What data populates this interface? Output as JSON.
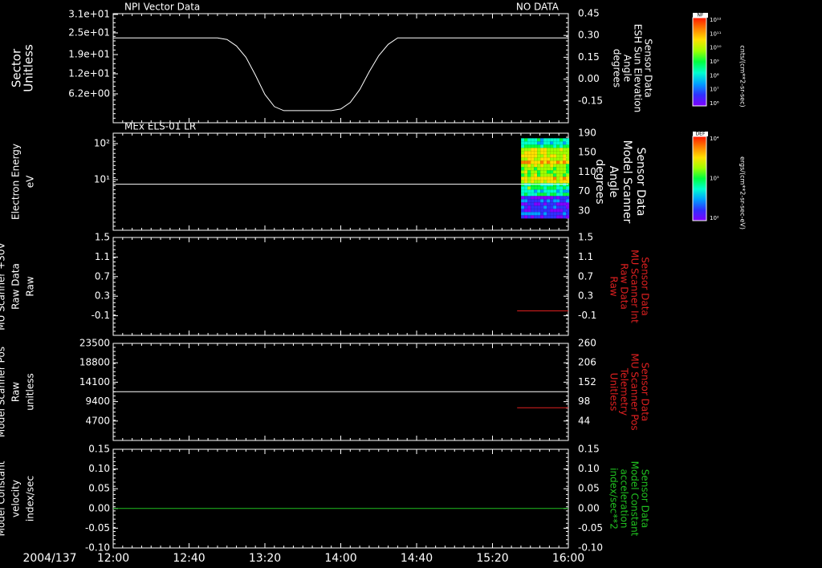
{
  "colors": {
    "background": "#000000",
    "axis": "#ffffff",
    "red": "#e02020",
    "green": "#20c020"
  },
  "chart_data": [
    {
      "type": "line",
      "title": "NPI Vector Data",
      "status": "NO DATA",
      "ylabel": [
        "Sector",
        "Unitless"
      ],
      "yticks": [
        "3.1e+01",
        "2.5e+01",
        "1.9e+01",
        "1.2e+01",
        "6.2e+00"
      ],
      "y2label": [
        "Sensor Data",
        "ESH Sun Elevation",
        "Angle",
        "degrees"
      ],
      "y2ticks": [
        "0.45",
        "0.30",
        "0.15",
        "0.00",
        "-0.15"
      ],
      "ylim2": [
        -0.225,
        0.45
      ],
      "series": [
        {
          "axis": "y2",
          "color": "#ffffff",
          "x": [
            "12:00",
            "12:55",
            "13:00",
            "13:05",
            "13:10",
            "13:15",
            "13:20",
            "13:25",
            "13:30",
            "13:55",
            "14:00",
            "14:05",
            "14:10",
            "14:15",
            "14:20",
            "14:25",
            "14:30",
            "16:00"
          ],
          "y": [
            0.3,
            0.3,
            0.29,
            0.25,
            0.18,
            0.07,
            -0.05,
            -0.125,
            -0.15,
            -0.15,
            -0.14,
            -0.1,
            -0.02,
            0.09,
            0.19,
            0.26,
            0.3,
            0.3
          ]
        }
      ]
    },
    {
      "type": "heatmap",
      "title": "MEx ELS-01 LR",
      "ylabel": [
        "Electron Energy",
        "eV"
      ],
      "yticks": [
        "10²",
        "10¹"
      ],
      "y2label": [
        "Sensor Data",
        "Model Scanner",
        "Angle",
        "degrees"
      ],
      "y2ticks": [
        "190",
        "150",
        "110",
        "70",
        "30"
      ],
      "ylim2": [
        0,
        190
      ],
      "line": {
        "axis": "y2",
        "x": [
          "12:00",
          "16:00"
        ],
        "y": [
          90,
          90
        ],
        "color": "#ffffff"
      },
      "spectrogram": {
        "x_start": "15:30",
        "x_end": "16:00",
        "y_start": 25,
        "y_end": 180
      },
      "colorbar": {
        "label": "DEF",
        "units": "ergs/(cm**2-sr-sec-eV)",
        "ticks": [
          "10⁴",
          "10³",
          "10²"
        ],
        "colors": [
          "#ff1800",
          "#ff8000",
          "#ffe000",
          "#a0ff00",
          "#00ff40",
          "#00ffd0",
          "#00a0ff",
          "#3030ff",
          "#8000ff"
        ]
      }
    },
    {
      "type": "line",
      "ylabel": [
        "Sensor Data",
        "MU Scanner +30V",
        "Raw Data",
        "Raw"
      ],
      "yticks": [
        "1.5",
        "1.1",
        "0.7",
        "0.3",
        "-0.1"
      ],
      "y2label": [
        "Sensor Data",
        "MU Scanner Int",
        "Raw Data",
        "Raw"
      ],
      "y2ticks": [
        "1.5",
        "1.1",
        "0.7",
        "0.3",
        "-0.1"
      ],
      "ylim2": [
        -0.5,
        1.5
      ],
      "series": [
        {
          "axis": "y2",
          "color": "#e02020",
          "x": [
            "15:33",
            "16:00"
          ],
          "y": [
            0.0,
            0.0
          ]
        }
      ]
    },
    {
      "type": "line",
      "ylabel": [
        "Sensor Data",
        "Model Scanner Pos",
        "Raw",
        "unitless"
      ],
      "yticks": [
        "23500",
        "18800",
        "14100",
        "9400",
        "4700"
      ],
      "y2label": [
        "Sensor Data",
        "MU Scanner Pos",
        "Telemetry",
        "Unitless"
      ],
      "y2ticks": [
        "260",
        "206",
        "152",
        "98",
        "44"
      ],
      "ylim": [
        0,
        23500
      ],
      "ylim2": [
        -10,
        260
      ],
      "series": [
        {
          "axis": "y",
          "color": "#ffffff",
          "x": [
            "12:00",
            "16:00"
          ],
          "y": [
            11800,
            11800
          ]
        },
        {
          "axis": "y2",
          "color": "#e02020",
          "x": [
            "15:33",
            "16:00"
          ],
          "y": [
            81,
            81
          ]
        }
      ]
    },
    {
      "type": "line",
      "ylabel": [
        "Sensor Data",
        "Model Constant",
        "velocity",
        "index/sec"
      ],
      "yticks": [
        "0.15",
        "0.10",
        "0.05",
        "0.00",
        "-0.05",
        "-0.10"
      ],
      "y2label": [
        "Sensor Data",
        "Model Constant",
        "acceleration",
        "index/sec**2"
      ],
      "y2ticks": [
        "0.15",
        "0.10",
        "0.05",
        "0.00",
        "-0.05",
        "-0.10"
      ],
      "ylim": [
        -0.1,
        0.15
      ],
      "series": [
        {
          "axis": "y",
          "color": "#20c020",
          "x": [
            "12:00",
            "16:00"
          ],
          "y": [
            0.0,
            0.0
          ]
        }
      ]
    }
  ],
  "top_colorbar": {
    "label": "NF",
    "units": "cnts/(cm**2-sr-sec)",
    "ticks": [
      "10¹²",
      "10¹¹",
      "10¹⁰",
      "10⁹",
      "10⁸",
      "10⁷",
      "10⁶"
    ],
    "colors": [
      "#ff1800",
      "#ff8000",
      "#ffe000",
      "#a0ff00",
      "#00ff40",
      "#00ffd0",
      "#00a0ff",
      "#3030ff",
      "#8000ff"
    ]
  },
  "xaxis": {
    "date": "2004/137",
    "ticks": [
      "12:00",
      "12:40",
      "13:20",
      "14:00",
      "14:40",
      "15:20",
      "16:00"
    ],
    "start": "12:00",
    "end": "16:00"
  }
}
